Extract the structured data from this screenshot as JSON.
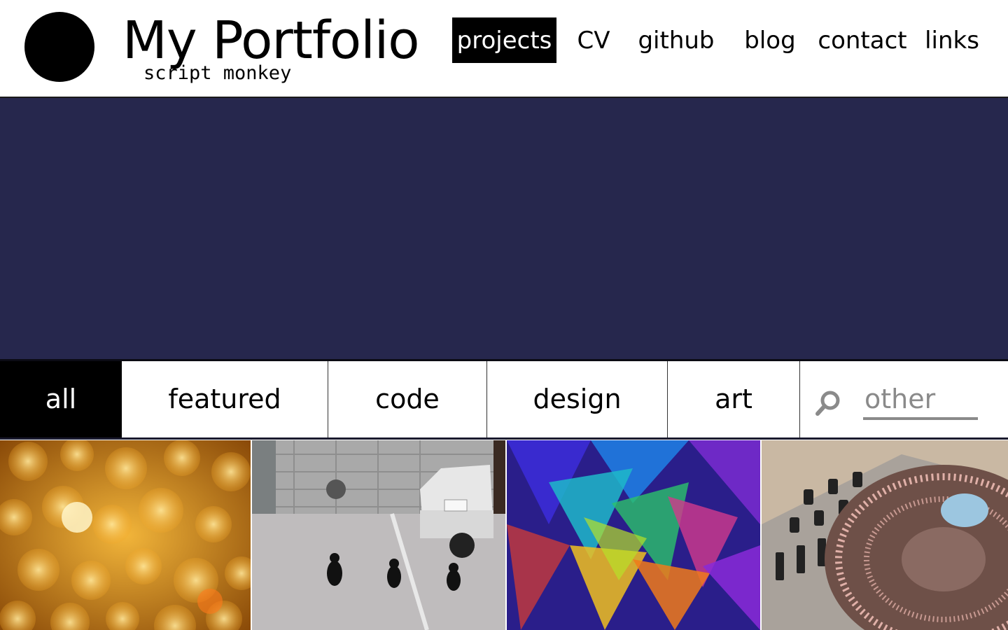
{
  "header": {
    "title": "My Portfolio",
    "subtitle": "script monkey"
  },
  "nav": {
    "items": [
      {
        "label": "projects",
        "active": true
      },
      {
        "label": "CV"
      },
      {
        "label": "github"
      },
      {
        "label": "blog"
      },
      {
        "label": "contact"
      },
      {
        "label": "links"
      }
    ]
  },
  "filters": {
    "tabs": [
      {
        "label": "all",
        "active": true
      },
      {
        "label": "featured"
      },
      {
        "label": "code"
      },
      {
        "label": "design"
      },
      {
        "label": "art"
      }
    ],
    "search": {
      "placeholder": "other",
      "icon": "search-icon"
    }
  },
  "colors": {
    "banner": "#26274d",
    "active_bg": "#000000",
    "active_text": "#ffffff"
  },
  "gallery": {
    "tiles": [
      {
        "name": "golden-bokeh-image"
      },
      {
        "name": "cats-parking-lot-image"
      },
      {
        "name": "colorful-polygons-image"
      },
      {
        "name": "dj-turntable-image"
      }
    ]
  }
}
